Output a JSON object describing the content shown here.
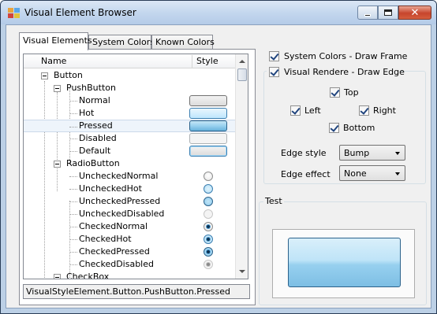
{
  "window": {
    "title": "Visual Element Browser",
    "icon": "app-icon",
    "controls": {
      "minimize": "minimize-icon",
      "maximize": "maximize-icon",
      "close": "close-icon"
    }
  },
  "tabs": [
    {
      "label": "Visual Elements",
      "active": true
    },
    {
      "label": "System Colors",
      "active": false
    },
    {
      "label": "Known Colors",
      "active": false
    }
  ],
  "tree": {
    "columns": {
      "name": "Name",
      "style": "Style"
    },
    "nodes": [
      {
        "label": "Button"
      },
      {
        "label": "PushButton"
      },
      {
        "label": "Normal"
      },
      {
        "label": "Hot"
      },
      {
        "label": "Pressed"
      },
      {
        "label": "Disabled"
      },
      {
        "label": "Default"
      },
      {
        "label": "RadioButton"
      },
      {
        "label": "UncheckedNormal"
      },
      {
        "label": "UncheckedHot"
      },
      {
        "label": "UncheckedPressed"
      },
      {
        "label": "UncheckedDisabled"
      },
      {
        "label": "CheckedNormal"
      },
      {
        "label": "CheckedHot"
      },
      {
        "label": "CheckedPressed"
      },
      {
        "label": "CheckedDisabled"
      },
      {
        "label": "CheckBox"
      }
    ]
  },
  "selected_path": "VisualStyleElement.Button.PushButton.Pressed",
  "options": {
    "system_colors_draw_frame": {
      "label": "System Colors - Draw Frame",
      "checked": true
    },
    "visual_renderer_draw_edge": {
      "label": "Visual Rendere - Draw Edge",
      "checked": true
    },
    "edges": {
      "top": {
        "label": "Top",
        "checked": true
      },
      "left": {
        "label": "Left",
        "checked": true
      },
      "right": {
        "label": "Right",
        "checked": true
      },
      "bottom": {
        "label": "Bottom",
        "checked": true
      }
    },
    "edge_style": {
      "label": "Edge style",
      "value": "Bump"
    },
    "edge_effect": {
      "label": "Edge effect",
      "value": "None"
    }
  },
  "test_group": {
    "title": "Test"
  },
  "colors": {
    "titlebar": "#c4d7ee",
    "selection": "#e3eef9",
    "accent": "#3c7fb1",
    "close": "#c7452c"
  }
}
